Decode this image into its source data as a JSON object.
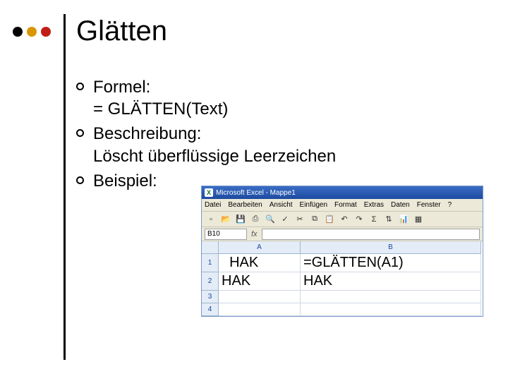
{
  "title": "Glätten",
  "bullets": [
    {
      "label": "Formel:",
      "sub": "= GLÄTTEN(Text)"
    },
    {
      "label": "Beschreibung:",
      "sub": "Löscht überflüssige Leerzeichen"
    },
    {
      "label": "Beispiel:",
      "sub": ""
    }
  ],
  "excel": {
    "titlebar": "Microsoft Excel - Mappe1",
    "menu": [
      "Datei",
      "Bearbeiten",
      "Ansicht",
      "Einfügen",
      "Format",
      "Extras",
      "Daten",
      "Fenster",
      "?"
    ],
    "toolbar_icons": [
      "new-file-icon",
      "open-icon",
      "save-icon",
      "print-icon",
      "preview-icon",
      "spellcheck-icon",
      "cut-icon",
      "copy-icon",
      "paste-icon",
      "undo-icon",
      "redo-icon",
      "bold-icon",
      "mail-icon",
      "sum-icon",
      "sort-icon",
      "chart-icon",
      "table-icon"
    ],
    "namebox": "B10",
    "columns": [
      "A",
      "B"
    ],
    "rows": [
      {
        "n": "1",
        "a": "  HAK",
        "b": "=GLÄTTEN(A1)",
        "big": true
      },
      {
        "n": "2",
        "a": "HAK",
        "b": "HAK",
        "big": true
      },
      {
        "n": "3",
        "a": "",
        "b": "",
        "big": false
      },
      {
        "n": "4",
        "a": "",
        "b": "",
        "big": false
      }
    ]
  }
}
